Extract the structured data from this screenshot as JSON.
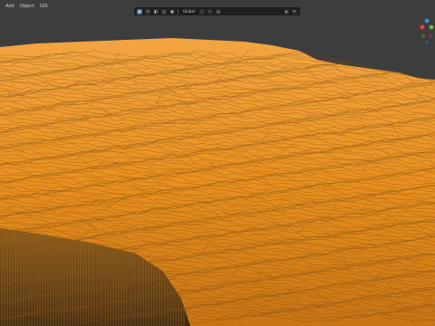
{
  "menu": {
    "items": [
      {
        "label": "Add"
      },
      {
        "label": "Object"
      },
      {
        "label": "GIS"
      }
    ]
  },
  "toolbar": {
    "orientation_label": "Global",
    "icons": [
      "cursor-icon",
      "view-icon",
      "shading-solid-icon",
      "overlay-icon",
      "xray-icon",
      "sphere-icon",
      "snap-icon",
      "proportional-icon",
      "viewport-shading-icon",
      "filter-icon"
    ]
  },
  "gizmo": {
    "axis_colors": {
      "x": "#e83e4f",
      "y": "#7bb43b",
      "z": "#3f8bd5"
    }
  },
  "scene": {
    "terrain_color": "#f59b2c",
    "background_color": "#3d3d3d"
  }
}
